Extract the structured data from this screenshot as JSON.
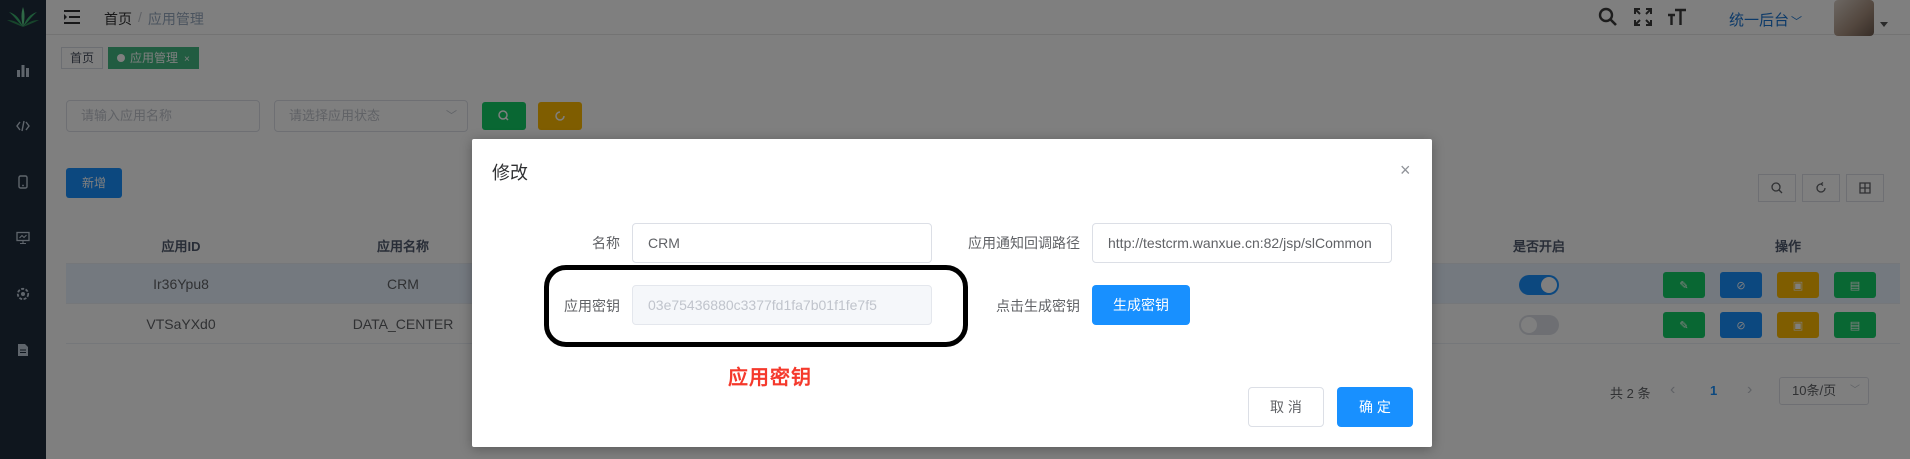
{
  "header": {
    "breadcrumb_home": "首页",
    "breadcrumb_sep": "/",
    "breadcrumb_current": "应用管理",
    "system_switch": "统一后台",
    "tool_icons": [
      "search-icon",
      "fullscreen-icon",
      "font-size-icon"
    ]
  },
  "sidebar": {
    "icons": [
      "chart-icon",
      "code-icon",
      "mobile-icon",
      "monitor-icon",
      "settings-icon",
      "document-icon"
    ]
  },
  "tags": {
    "home": "首页",
    "active": "应用管理",
    "close": "×"
  },
  "filters": {
    "name_placeholder": "请输入应用名称",
    "status_placeholder": "请选择应用状态",
    "add_label": "新增"
  },
  "table": {
    "columns": [
      "应用ID",
      "应用名称",
      "是否开启",
      "操作"
    ],
    "rows": [
      {
        "id": "Ir36Ypu8",
        "name": "CRM",
        "enabled": true
      },
      {
        "id": "VTSaYXd0",
        "name": "DATA_CENTER",
        "enabled": false
      }
    ]
  },
  "pagination": {
    "total": "共 2 条",
    "prev": "‹",
    "page": "1",
    "next": "›",
    "page_size": "10条/页"
  },
  "dialog": {
    "title": "修改",
    "close": "×",
    "name_label": "名称",
    "name_value": "CRM",
    "callback_label": "应用通知回调路径",
    "callback_value": "http://testcrm.wanxue.cn:82/jsp/slCommon",
    "secret_label": "应用密钥",
    "secret_value": "03e75436880c3377fd1fa7b01f1fe7f5",
    "generate_label": "点击生成密钥",
    "generate_button": "生成密钥",
    "annotation": "应用密钥",
    "cancel": "取 消",
    "confirm": "确 定"
  },
  "colors": {
    "primary": "#1890ff",
    "success": "#13ce66",
    "warning": "#ffba00",
    "sidebar": "#1f2d3d",
    "tag_active": "#42b983",
    "annotation": "#f5392c"
  }
}
